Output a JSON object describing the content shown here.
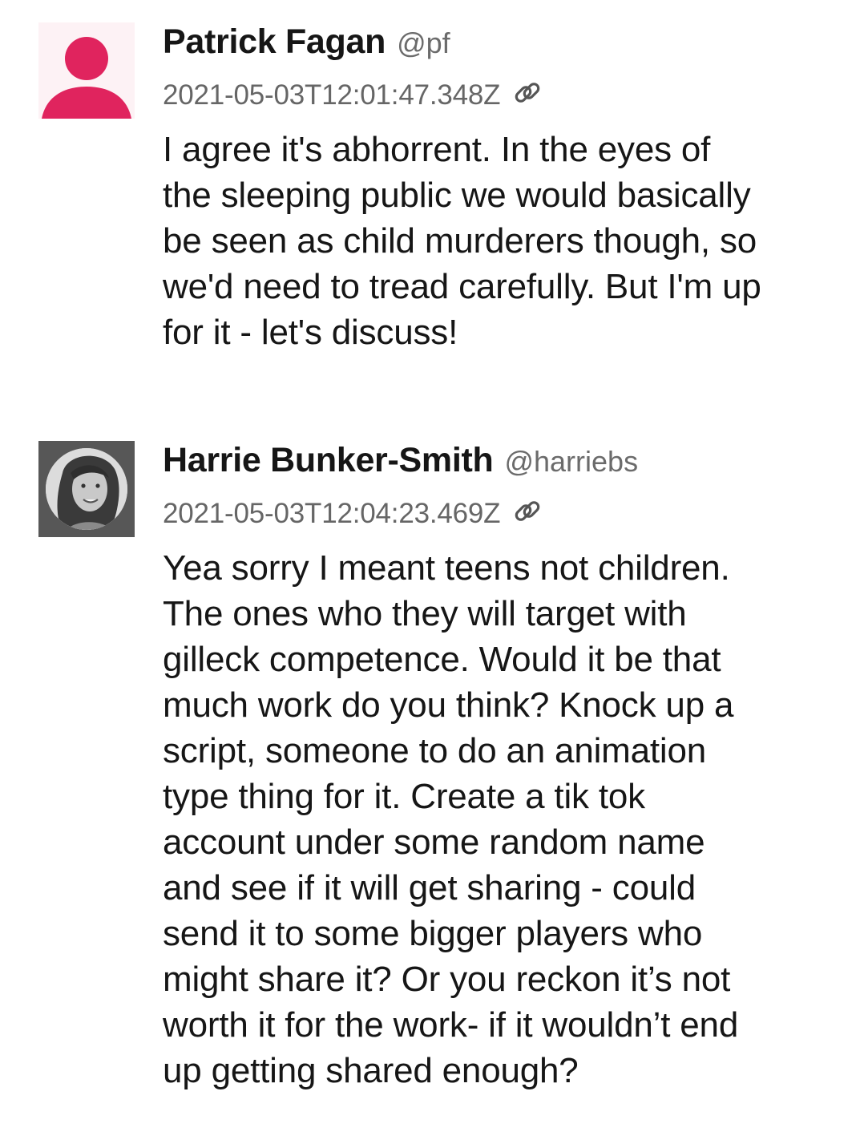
{
  "posts": [
    {
      "display_name": "Patrick Fagan",
      "handle": "@pf",
      "timestamp": "2021-05-03T12:01:47.348Z",
      "avatar": "default-person-avatar",
      "body_lines": [
        "I agree it's abhorrent. In the eyes of",
        "the sleeping public we would basically",
        "be seen as child murderers though, so",
        "we'd need to tread carefully. But I'm up",
        "for it - let's discuss!"
      ]
    },
    {
      "display_name": "Harrie Bunker-Smith",
      "handle": "@harriebs",
      "timestamp": "2021-05-03T12:04:23.469Z",
      "avatar": "profile-photo-avatar",
      "body_lines": [
        "Yea sorry I meant teens not children.",
        "The ones who they will target with",
        "gilleck competence. Would it be that",
        "much work do you think? Knock up a",
        "script, someone to do an animation",
        "type thing for it. Create a tik tok",
        "account under some random name",
        "and see if it will get sharing - could",
        "send it to some bigger players who",
        "might share it? Or you reckon it’s not",
        "worth it for the work- if it wouldn’t end",
        "up getting shared enough?"
      ]
    }
  ],
  "icons": {
    "permalink": "link-icon"
  },
  "colors": {
    "default_avatar": "#e0245e",
    "default_avatar_bg": "#fdf2f5",
    "timestamp": "#666666",
    "handle": "#6b6b6b"
  }
}
